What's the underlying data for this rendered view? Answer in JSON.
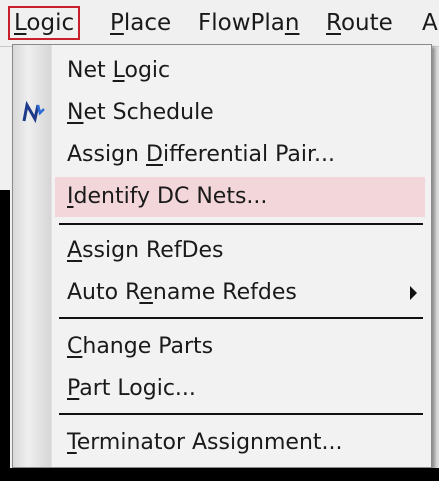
{
  "menubar": {
    "items": [
      {
        "pre": "",
        "u": "L",
        "post": "ogic"
      },
      {
        "pre": "",
        "u": "P",
        "post": "lace"
      },
      {
        "pre": "FlowPla",
        "u": "n",
        "post": ""
      },
      {
        "pre": "",
        "u": "R",
        "post": "oute"
      },
      {
        "pre": "",
        "u": "",
        "post": "A"
      }
    ]
  },
  "menu": {
    "items": [
      {
        "pre": "Net ",
        "u": "L",
        "post": "ogic"
      },
      {
        "pre": "",
        "u": "N",
        "post": "et Schedule",
        "icon": "net-schedule-icon"
      },
      {
        "pre": "Assign ",
        "u": "D",
        "post": "ifferential Pair..."
      },
      {
        "pre": "",
        "u": "I",
        "post": "dentify DC Nets...",
        "highlighted": true
      },
      {
        "pre": "",
        "u": "A",
        "post": "ssign RefDes"
      },
      {
        "pre": "Auto R",
        "u": "e",
        "post": "name Refdes",
        "submenu": true
      },
      {
        "pre": "",
        "u": "C",
        "post": "hange Parts"
      },
      {
        "pre": "",
        "u": "P",
        "post": "art Logic..."
      },
      {
        "pre": "",
        "u": "T",
        "post": "erminator Assignment..."
      }
    ]
  }
}
